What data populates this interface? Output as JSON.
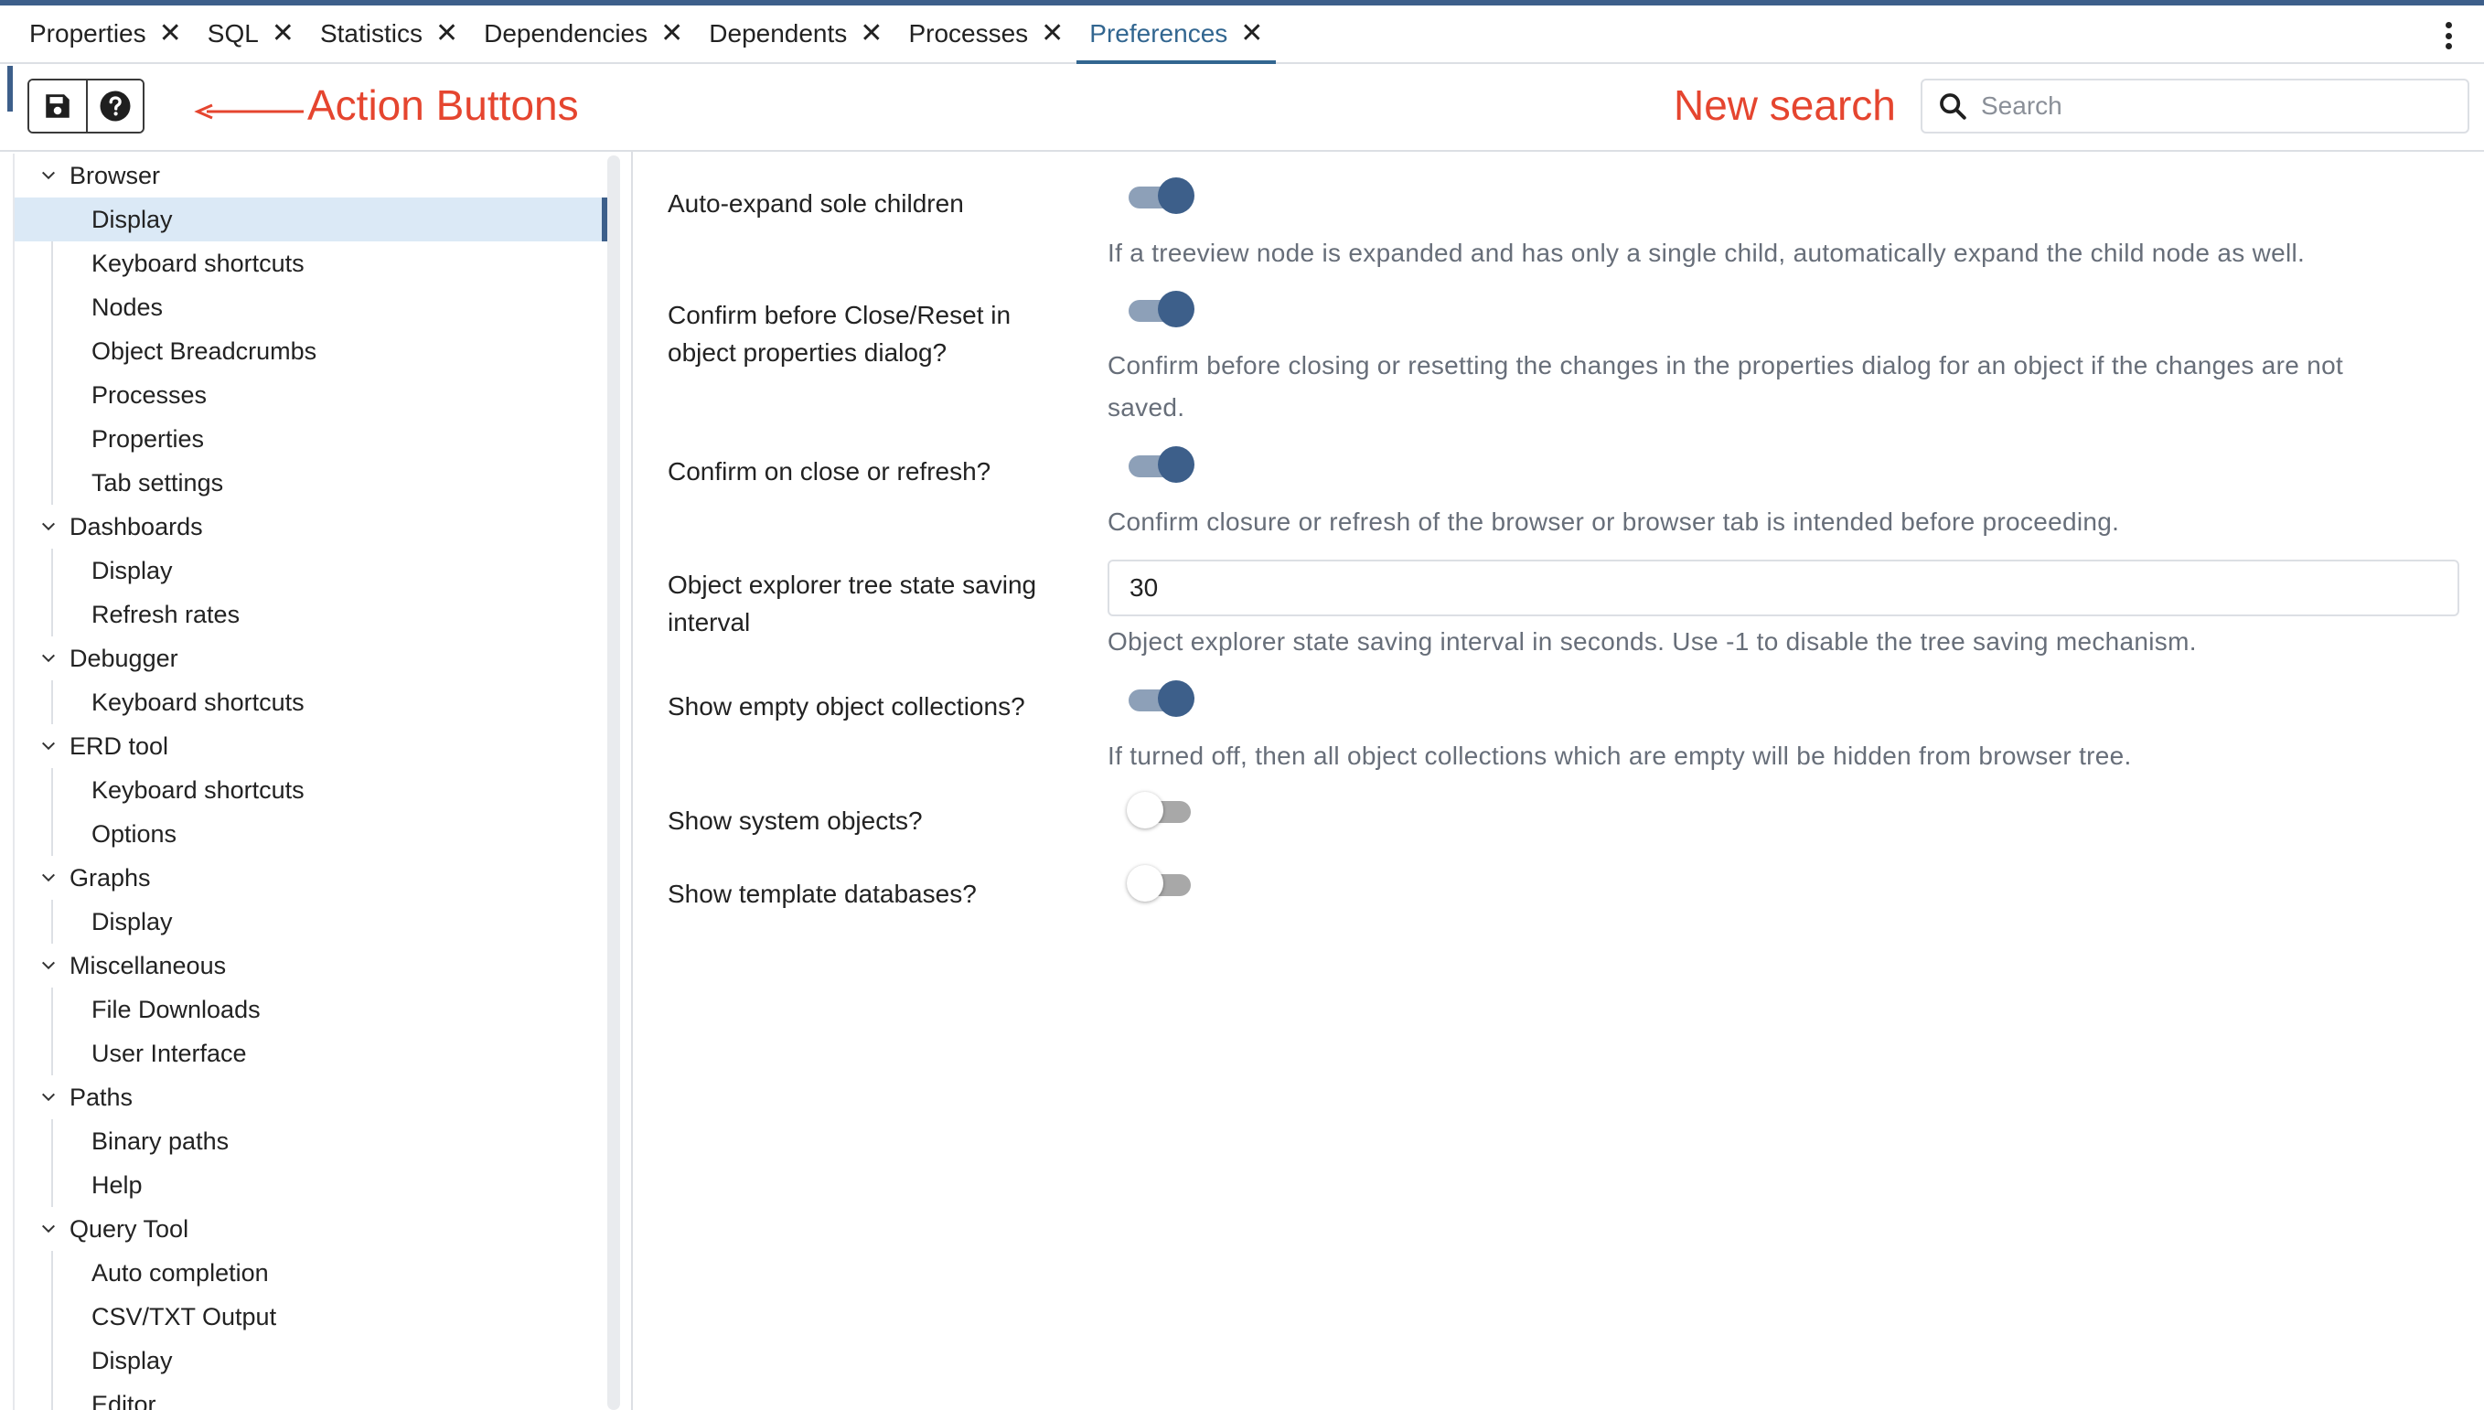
{
  "tabs": [
    {
      "label": "Properties",
      "active": false
    },
    {
      "label": "SQL",
      "active": false
    },
    {
      "label": "Statistics",
      "active": false
    },
    {
      "label": "Dependencies",
      "active": false
    },
    {
      "label": "Dependents",
      "active": false
    },
    {
      "label": "Processes",
      "active": false
    },
    {
      "label": "Preferences",
      "active": true
    }
  ],
  "toolbar": {
    "save_icon": "floppy-disk-icon",
    "help_icon": "question-circle-icon",
    "annotation_action": "Action Buttons",
    "annotation_search": "New search",
    "search_placeholder": "Search",
    "annotation_color": "#e5452f"
  },
  "sidebar": {
    "groups": [
      {
        "label": "Browser",
        "items": [
          "Display",
          "Keyboard shortcuts",
          "Nodes",
          "Object Breadcrumbs",
          "Processes",
          "Properties",
          "Tab settings"
        ]
      },
      {
        "label": "Dashboards",
        "items": [
          "Display",
          "Refresh rates"
        ]
      },
      {
        "label": "Debugger",
        "items": [
          "Keyboard shortcuts"
        ]
      },
      {
        "label": "ERD tool",
        "items": [
          "Keyboard shortcuts",
          "Options"
        ]
      },
      {
        "label": "Graphs",
        "items": [
          "Display"
        ]
      },
      {
        "label": "Miscellaneous",
        "items": [
          "File Downloads",
          "User Interface"
        ]
      },
      {
        "label": "Paths",
        "items": [
          "Binary paths",
          "Help"
        ]
      },
      {
        "label": "Query Tool",
        "items": [
          "Auto completion",
          "CSV/TXT Output",
          "Display",
          "Editor"
        ]
      }
    ],
    "selected": "Browser/Display"
  },
  "settings": {
    "auto_expand": {
      "label": "Auto-expand sole children",
      "value": true,
      "help": "If a treeview node is expanded and has only a single child, automatically expand the child node as well."
    },
    "confirm_close_reset": {
      "label_line1": "Confirm before Close/Reset in",
      "label_line2": "object properties dialog?",
      "value": true,
      "help_line1": "Confirm before closing or resetting the changes in the properties dialog for an object if the changes are not",
      "help_line2": "saved."
    },
    "confirm_close_refresh": {
      "label": "Confirm on close or refresh?",
      "value": true,
      "help": "Confirm closure or refresh of the browser or browser tab is intended before proceeding."
    },
    "tree_state_interval": {
      "label_line1": "Object explorer tree state saving",
      "label_line2": "interval",
      "value": "30",
      "help": "Object explorer state saving interval in seconds. Use -1 to disable the tree saving mechanism."
    },
    "show_empty_collections": {
      "label": "Show empty object collections?",
      "value": true,
      "help": "If turned off, then all object collections which are empty will be hidden from browser tree."
    },
    "show_system_objects": {
      "label": "Show system objects?",
      "value": false
    },
    "show_template_databases": {
      "label": "Show template databases?",
      "value": false
    }
  },
  "colors": {
    "accent": "#3d5f8a",
    "active_tab_text": "#326690",
    "selected_row_bg": "#dbe9f6",
    "help_text": "#676e79"
  }
}
